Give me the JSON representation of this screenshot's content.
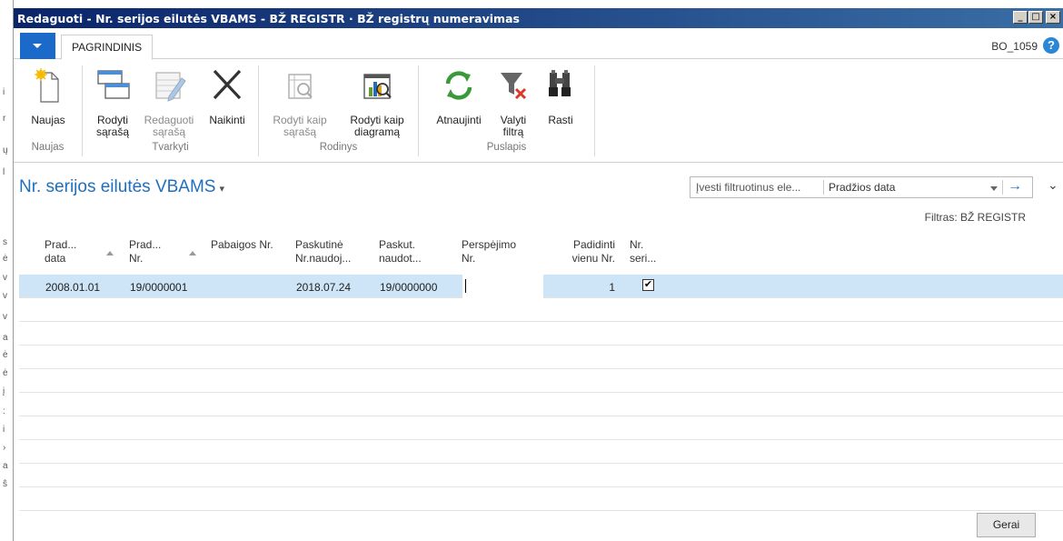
{
  "window": {
    "title": "Redaguoti - Nr. serijos eilutės VBAMS - BŽ REGISTR · BŽ registrų numeravimas",
    "controls": {
      "minimize": "_",
      "maximize": "□",
      "close": "×"
    }
  },
  "ribbon": {
    "tab": "PAGRINDINIS",
    "user": "BO_1059",
    "help": "?",
    "groups": [
      {
        "label": "Naujas",
        "buttons": [
          {
            "label": "Naujas",
            "icon": "new-document-icon",
            "enabled": true
          }
        ]
      },
      {
        "label": "Tvarkyti",
        "buttons": [
          {
            "label": "Rodyti sąrašą",
            "icon": "view-list-icon",
            "enabled": true
          },
          {
            "label": "Redaguoti sąrašą",
            "icon": "edit-list-icon",
            "enabled": false
          },
          {
            "label": "Naikinti",
            "icon": "delete-x-icon",
            "enabled": true
          }
        ]
      },
      {
        "label": "Rodinys",
        "buttons": [
          {
            "label": "Rodyti kaip sąrašą",
            "icon": "show-as-list-icon",
            "enabled": false
          },
          {
            "label": "Rodyti kaip diagramą",
            "icon": "show-as-chart-icon",
            "enabled": true
          }
        ]
      },
      {
        "label": "Puslapis",
        "buttons": [
          {
            "label": "Atnaujinti",
            "icon": "refresh-icon",
            "enabled": true
          },
          {
            "label": "Valyti filtrą",
            "icon": "clear-filter-icon",
            "enabled": true
          },
          {
            "label": "Rasti",
            "icon": "binoculars-icon",
            "enabled": true
          }
        ]
      }
    ]
  },
  "page": {
    "title": "Nr. serijos eilutės VBAMS",
    "caret": "▾",
    "filter_placeholder": "Įvesti filtruotinus ele...",
    "filter_field": "Pradžios data",
    "filter_go": "→",
    "collapse": "⌄",
    "filter_text": "Filtras: BŽ REGISTR"
  },
  "columns": [
    {
      "line1": "Prad...",
      "line2": "data"
    },
    {
      "line1": "Prad...",
      "line2": "Nr."
    },
    {
      "line1": "Pabaigos Nr.",
      "line2": ""
    },
    {
      "line1": "Paskutinė",
      "line2": "Nr.naudoj..."
    },
    {
      "line1": "Paskut.",
      "line2": "naudot..."
    },
    {
      "line1": "Perspėjimo",
      "line2": "Nr."
    },
    {
      "line1": "Padidinti",
      "line2": "vienu Nr."
    },
    {
      "line1": "Nr.",
      "line2": "seri..."
    }
  ],
  "rows": [
    {
      "start_date": "2008.01.01",
      "start_no": "19/0000001",
      "end_no": "",
      "last_date_used": "2018.07.24",
      "last_no_used": "19/0000000",
      "warning_no": "",
      "increment": "1",
      "series_checked": "✔"
    }
  ],
  "footer": {
    "ok_label": "Gerai"
  },
  "background_window_chars": [
    "i",
    "r",
    "ų",
    "l",
    "s",
    "ė",
    "v",
    "v",
    "v",
    "a",
    "ė",
    "ė",
    "į",
    ":",
    "i",
    "›",
    "a",
    "ŝ"
  ]
}
